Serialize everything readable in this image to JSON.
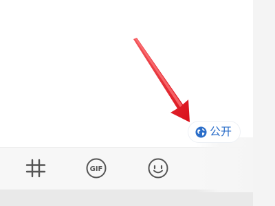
{
  "composer": {
    "visibility_label": "公开"
  },
  "toolbar": {
    "items": [
      {
        "name": "hashtag",
        "icon": "hashtag-icon"
      },
      {
        "name": "gif",
        "icon": "gif-icon",
        "label": "GIF"
      },
      {
        "name": "emoji",
        "icon": "emoji-icon"
      }
    ]
  },
  "colors": {
    "accent": "#2b6ec9",
    "arrow": "#e8141b",
    "toolbar_bg": "#f7f7f7",
    "icon": "#555555"
  }
}
